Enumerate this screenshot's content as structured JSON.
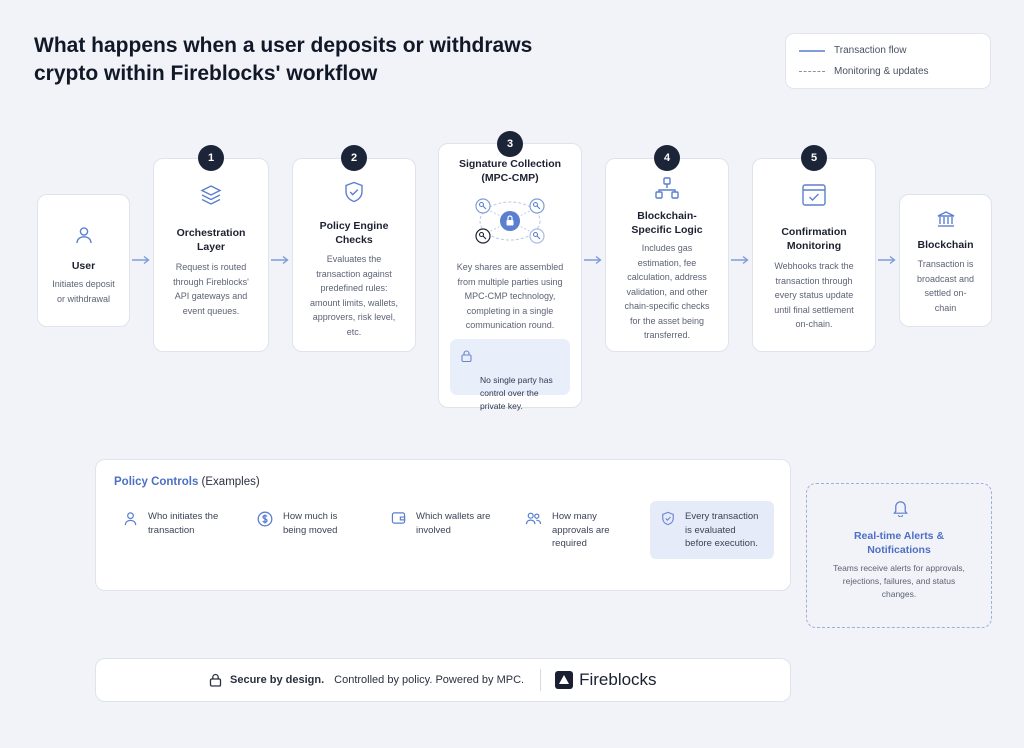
{
  "header": {
    "title": "What happens when a user deposits or withdraws\ncrypto within Fireblocks' workflow"
  },
  "legend": {
    "transaction_flow": "Transaction flow",
    "monitoring": "Monitoring & updates"
  },
  "steps": {
    "user": {
      "title": "User",
      "desc": "Initiates deposit\nor withdrawal",
      "icon": "user-icon"
    },
    "s1": {
      "number": "1",
      "title": "Orchestration\nLayer",
      "desc": "Request is routed\nthrough Fireblocks'\nAPI gateways and\nevent queues.",
      "icon": "layers-icon"
    },
    "s2": {
      "number": "2",
      "title": "Policy Engine\nChecks",
      "desc": "Evaluates the\ntransaction against\npredefined rules:\namount limits, wallets,\napprovers, risk level,\netc.",
      "icon": "shield-check-icon"
    },
    "s3": {
      "number": "3",
      "title": "Signature Collection\n(MPC-CMP)",
      "desc": "Key shares are assembled\nfrom multiple parties using\nMPC-CMP technology,\ncompleting in a single\ncommunication round.",
      "icon": "key-network-icon",
      "note": "No single party has\ncontrol over the\nprivate key."
    },
    "s4": {
      "number": "4",
      "title": "Blockchain-\nSpecific Logic",
      "desc": "Includes gas\nestimation, fee\ncalculation, address\nvalidation, and other\nchain-specific checks\nfor the asset being\ntransferred.",
      "icon": "network-icon"
    },
    "s5": {
      "number": "5",
      "title": "Confirmation\nMonitoring",
      "desc": "Webhooks track the\ntransaction through\nevery status update\nuntil final settlement\non-chain.",
      "icon": "window-check-icon"
    },
    "chain": {
      "title": "Blockchain",
      "desc": "Transaction is\nbroadcast and\nsettled on-\nchain",
      "icon": "bank-icon"
    }
  },
  "policy": {
    "title_accent": "Policy Controls",
    "title_rest": " (Examples)",
    "items": [
      {
        "label": "Who initiates the\ntransaction",
        "icon": "user-icon"
      },
      {
        "label": "How much is\nbeing moved",
        "icon": "dollar-icon"
      },
      {
        "label": "Which wallets are\ninvolved",
        "icon": "wallet-icon"
      },
      {
        "label": "How many\napprovals are\nrequired",
        "icon": "users-icon"
      },
      {
        "label": "Every transaction\nis evaluated\nbefore execution.",
        "icon": "shield-check-icon"
      }
    ]
  },
  "alerts": {
    "title": "Real-time Alerts &\nNotifications",
    "desc": "Teams receive alerts for approvals,\nrejections, failures, and status\nchanges.",
    "icon": "bell-icon"
  },
  "footer": {
    "bold": "Secure by design.",
    "text": "Controlled by policy. Powered by MPC.",
    "brand": "Fireblocks"
  },
  "colors": {
    "accent": "#4d6fc4",
    "dark": "#1c2438",
    "line": "#7f9ed7",
    "highlight": "#e6ebf9"
  }
}
